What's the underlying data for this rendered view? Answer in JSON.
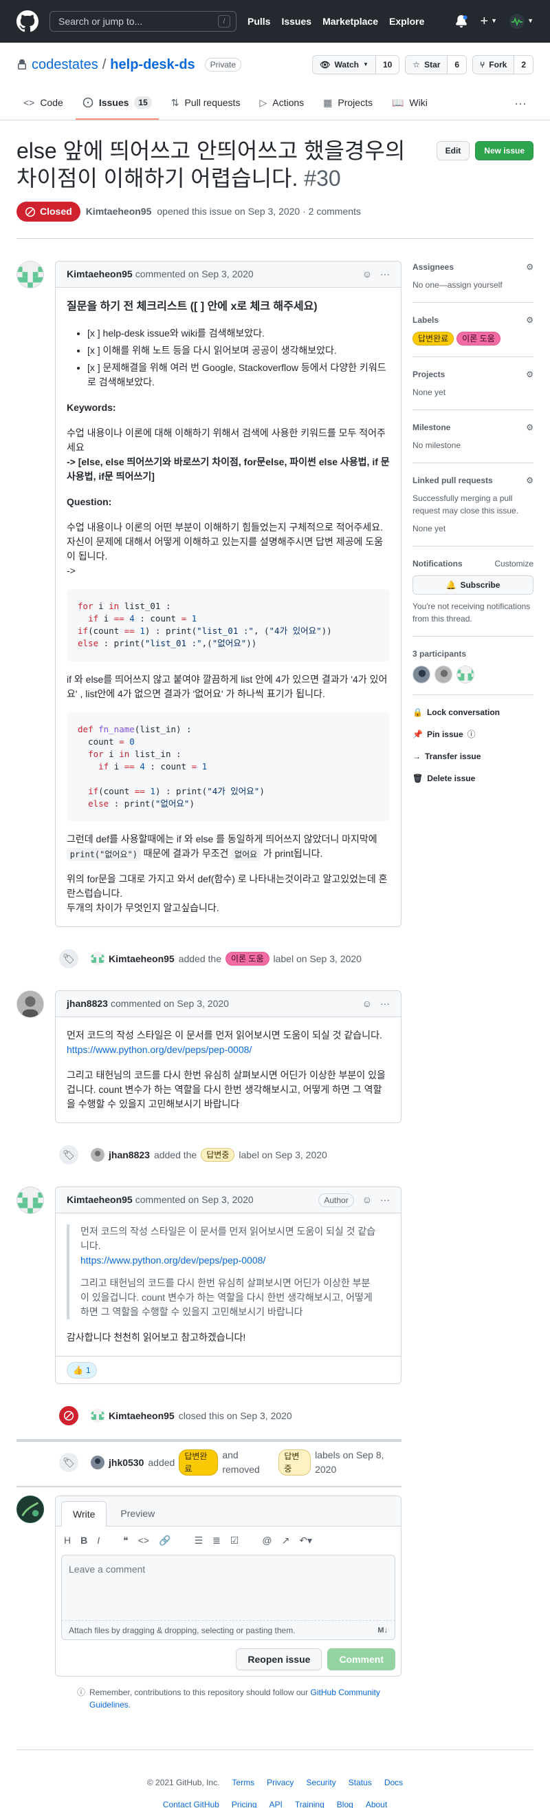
{
  "header": {
    "search_placeholder": "Search or jump to...",
    "slash_hint": "/",
    "nav": [
      "Pulls",
      "Issues",
      "Marketplace",
      "Explore"
    ],
    "plus_label": "+"
  },
  "repo": {
    "owner": "codestates",
    "separator": "/",
    "name": "help-desk-ds",
    "visibility": "Private",
    "watch_label": "Watch",
    "watch_count": "10",
    "star_label": "Star",
    "star_count": "6",
    "fork_label": "Fork",
    "fork_count": "2",
    "tabs": [
      {
        "label": "Code",
        "icon": "code-icon"
      },
      {
        "label": "Issues",
        "icon": "issue-icon",
        "counter": "15"
      },
      {
        "label": "Pull requests",
        "icon": "pr-icon"
      },
      {
        "label": "Actions",
        "icon": "play-icon"
      },
      {
        "label": "Projects",
        "icon": "project-icon"
      },
      {
        "label": "Wiki",
        "icon": "book-icon"
      }
    ]
  },
  "issue": {
    "title": "else 앞에 띄어쓰고 안띄어쓰고 했을경우의 차이점이 이해하기 어렵습니다.",
    "number": "#30",
    "edit_label": "Edit",
    "new_issue_label": "New issue",
    "state": "Closed",
    "author": "Kimtaeheon95",
    "opened_text": "opened this issue on Sep 3, 2020 · 2 comments"
  },
  "first_comment": {
    "author": "Kimtaeheon95",
    "meta": "commented on Sep 3, 2020",
    "heading": "질문을 하기 전 체크리스트 ([ ] 안에 x로 체크 해주세요)",
    "checklist": [
      "[x ] help-desk issue와 wiki를 검색해보았다.",
      "[x ] 이해를 위해 노트 등을 다시 읽어보며 공공이 생각해보았다.",
      "[x ] 문제해결을 위해 여러 번 Google, Stackoverflow 등에서 다양한 키워드로 검색해보았다."
    ],
    "keywords_label": "Keywords:",
    "keywords_intro": "수업 내용이나 이론에 대해 이해하기 위해서 검색에 사용한 키워드를 모두 적어주세요",
    "keywords_value": "-> [else, else 띄어쓰기와 바로쓰기 차이점, for문else, 파이썬 else 사용법, if 문 사용법, if문 띄어쓰기]",
    "question_label": "Question:",
    "question_text": "수업 내용이나 이론의 어떤 부분이 이해하기 힘들었는지 구체적으로 적어주세요. 자신이 문제에 대해서 어떻게 이해하고 있는지를 설명해주시면 답변 제공에 도움이 됩니다.",
    "question_arrow": "->",
    "code1": [
      "for i in list_01 :",
      "  if i == 4 : count = 1",
      "if(count == 1) : print(\"list_01 :\", (\"4가 있어요\"))",
      "else : print(\"list_01 :\",(\"없어요\"))"
    ],
    "para1": "if 와 else를 띄어쓰지 않고 붙여야 깔끔하게 list 안에 4가 있으면 결과가 '4가 있어요' , list안에 4가 없으면 결과가 '없어요' 가 하나씩 표기가 됩니다.",
    "code2": [
      "def fn_name(list_in) :",
      "  count = 0",
      "  for i in list_in :",
      "    if i == 4 : count = 1",
      "",
      "  if(count == 1) : print(\"4가 있어요\")",
      "  else : print(\"없어요\")"
    ],
    "para2_a": "그런데 def를 사용할때에는 if 와 else 를 동일하게 띄어쓰지 않았더니 마지막에",
    "para2_code1": "print(\"없어요\")",
    "para2_b": "때문에 결과가 무조건",
    "para2_code2": "없어요",
    "para2_c": "가 print됩니다.",
    "para3_a": "위의 for문을 그대로 가지고 와서 def(함수) 로 나타내는것이라고 알고있었는데 혼란스럽습니다.",
    "para3_b": "두개의 차이가 무엇인지 알고싶습니다."
  },
  "event_label1": {
    "actor": "Kimtaeheon95",
    "action": "added the",
    "label": "이론 도움",
    "suffix": "label on Sep 3, 2020"
  },
  "second_comment": {
    "author": "jhan8823",
    "meta": "commented on Sep 3, 2020",
    "p1": "먼저 코드의 작성 스타일은 이 문서를 먼저 읽어보시면 도움이 되실 것 같습니다.",
    "link": "https://www.python.org/dev/peps/pep-0008/",
    "p2": "그리고 태헌님의 코드를 다시 한번 유심히 살펴보시면 어딘가 이상한 부분이 있을겁니다. count 변수가 하는 역할을 다시 한번 생각해보시고, 어떻게 하면 그 역할을 수행할 수 있을지 고민해보시기 바랍니다"
  },
  "event_label2": {
    "actor": "jhan8823",
    "action": "added the",
    "label": "답변중",
    "suffix": "label on Sep 3, 2020"
  },
  "third_comment": {
    "author": "Kimtaeheon95",
    "meta": "commented on Sep 3, 2020",
    "badge": "Author",
    "quote_p1": "먼저 코드의 작성 스타일은 이 문서를 먼저 읽어보시면 도움이 되실 것 같습니다.",
    "quote_link": "https://www.python.org/dev/peps/pep-0008/",
    "quote_p2": "그리고 태헌님의 코드를 다시 한번 유심히 살펴보시면 어딘가 이상한 부분이 있을겁니다. count 변수가 하는 역할을 다시 한번 생각해보시고, 어떻게 하면 그 역할을 수행할 수 있을지 고민해보시기 바랍니다",
    "reply": "감사합니다 천천히 읽어보고 참고하겠습니다!",
    "reaction_emoji": "👍",
    "reaction_count": "1"
  },
  "event_closed": {
    "actor": "Kimtaeheon95",
    "text": "closed this on Sep 3, 2020"
  },
  "event_labels": {
    "actor": "jhk0530",
    "added": "added",
    "label_added": "답변완료",
    "removed": "and removed",
    "label_removed": "답변중",
    "suffix": "labels on Sep 8, 2020"
  },
  "form": {
    "tab_write": "Write",
    "tab_preview": "Preview",
    "placeholder": "Leave a comment",
    "attach": "Attach files by dragging & dropping, selecting or pasting them.",
    "reopen": "Reopen issue",
    "comment": "Comment",
    "remember_a": "Remember, contributions to this repository should follow our",
    "remember_link": "GitHub Community Guidelines",
    "remember_end": "."
  },
  "sidebar": {
    "assignees": "Assignees",
    "assignees_val": "No one—assign yourself",
    "labels": "Labels",
    "label_list": [
      "답변완료",
      "이론 도움"
    ],
    "projects": "Projects",
    "projects_val": "None yet",
    "milestone": "Milestone",
    "milestone_val": "No milestone",
    "linked": "Linked pull requests",
    "linked_desc": "Successfully merging a pull request may close this issue.",
    "linked_val": "None yet",
    "notifications": "Notifications",
    "customize": "Customize",
    "subscribe": "Subscribe",
    "notif_desc": "You're not receiving notifications from this thread.",
    "participants": "3 participants",
    "lock": "Lock conversation",
    "pin": "Pin issue",
    "transfer": "Transfer issue",
    "delete": "Delete issue"
  },
  "footer": {
    "copyright": "© 2021 GitHub, Inc.",
    "row1": [
      "Terms",
      "Privacy",
      "Security",
      "Status",
      "Docs"
    ],
    "row2": [
      "Contact GitHub",
      "Pricing",
      "API",
      "Training",
      "Blog",
      "About"
    ]
  },
  "colors": {
    "closed_red": "#cf222e",
    "green": "#2da44e",
    "label_pink": "#f26ba3",
    "label_yellow": "#fbca04",
    "label_beige": "#fef2c0",
    "link_blue": "#0969da"
  }
}
